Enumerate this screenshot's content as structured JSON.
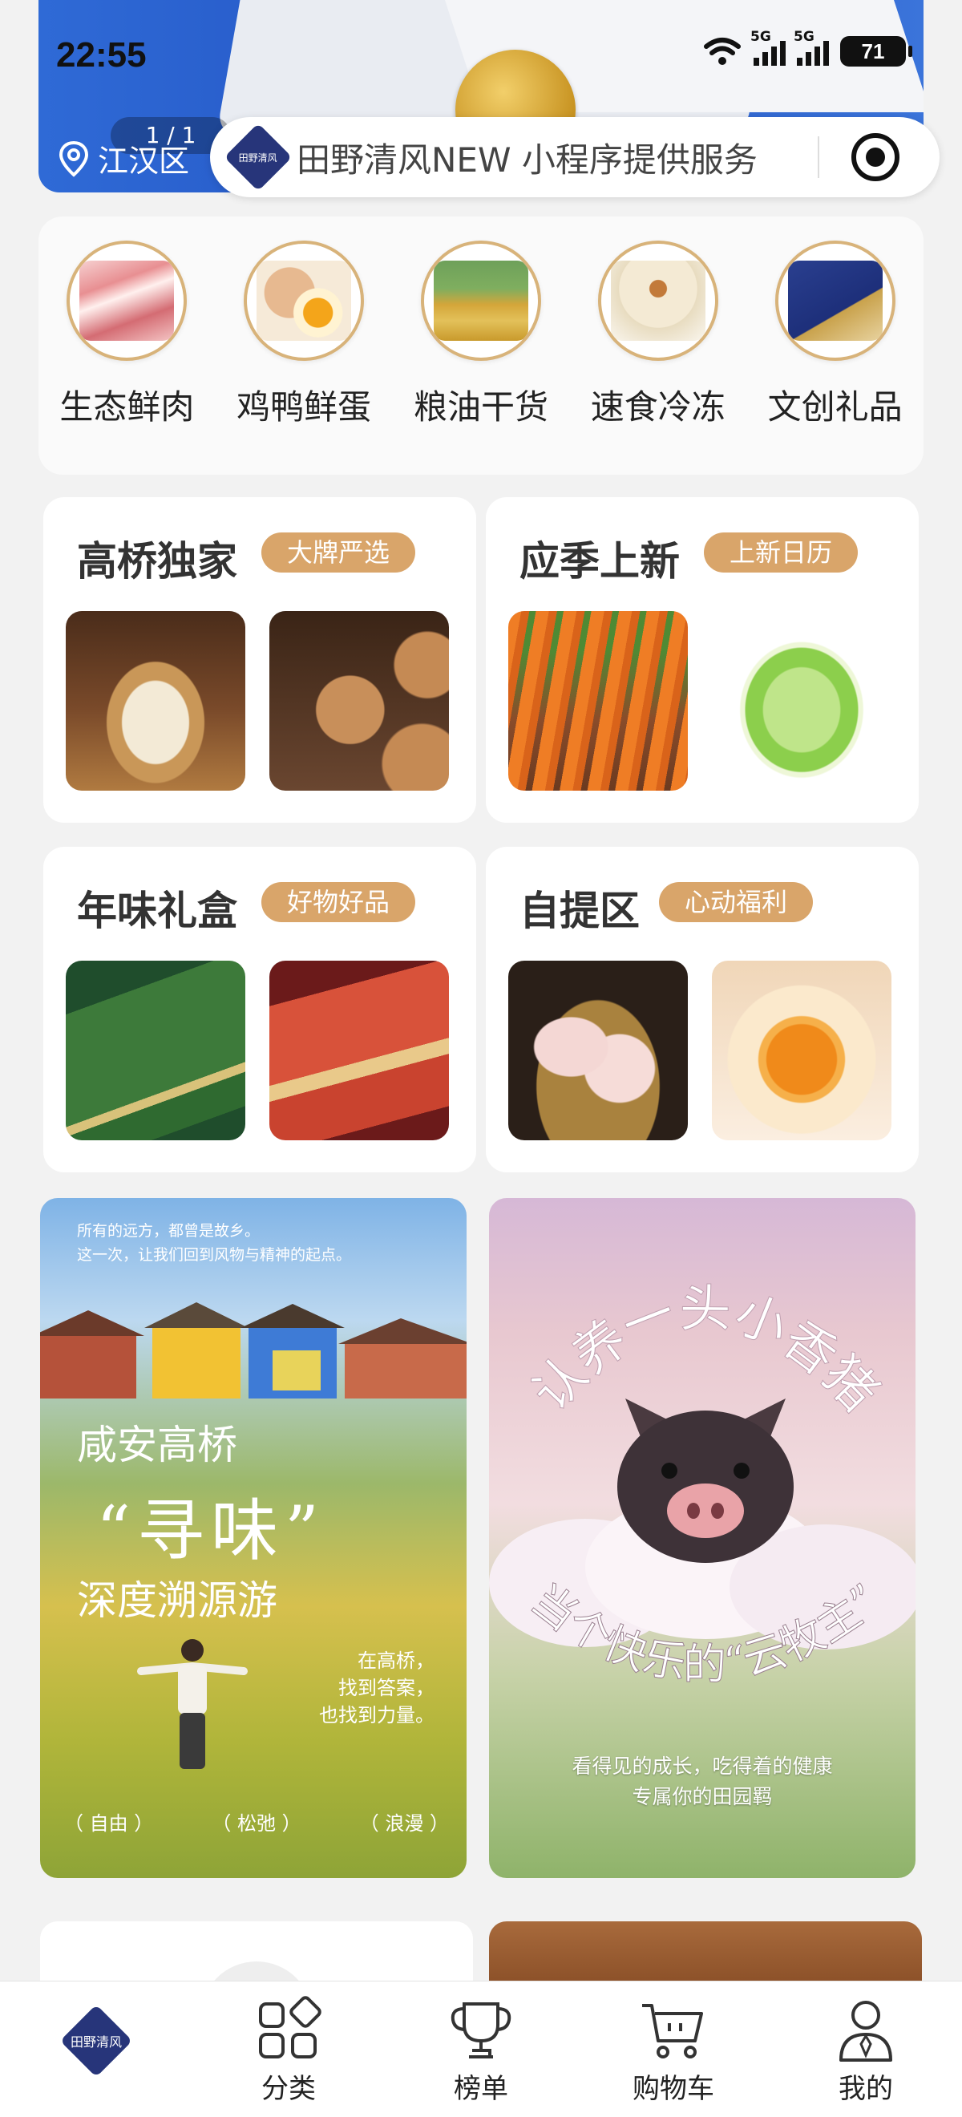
{
  "status_bar": {
    "time": "22:55",
    "network_1": "5G",
    "network_2": "5G",
    "battery": "71"
  },
  "banner": {
    "page_indicator": "1 / 1"
  },
  "location": {
    "district": "江汉区"
  },
  "search": {
    "logo_text": "田野清风",
    "service_text": "田野清风NEW 小程序提供服务"
  },
  "categories": [
    {
      "label": "生态鲜肉",
      "icon": "pork-icon"
    },
    {
      "label": "鸡鸭鲜蛋",
      "icon": "egg-icon"
    },
    {
      "label": "粮油干货",
      "icon": "grain-oil-icon"
    },
    {
      "label": "速食冷冻",
      "icon": "dumpling-icon"
    },
    {
      "label": "文创礼品",
      "icon": "gift-box-icon"
    }
  ],
  "feature_cards": [
    {
      "title": "高桥独家",
      "badge": "大牌严选"
    },
    {
      "title": "应季上新",
      "badge": "上新日历"
    },
    {
      "title": "年味礼盒",
      "badge": "好物好品"
    },
    {
      "title": "自提区",
      "badge": "心动福利"
    }
  ],
  "posters": {
    "left": {
      "intro_1": "所有的远方，都曾是故乡。",
      "intro_2": "这一次，让我们回到风物与精神的起点。",
      "title_1": "咸安高桥",
      "title_2": "“寻味”",
      "title_3": "深度溯源游",
      "sub_1": "在高桥，",
      "sub_2": "找到答案，",
      "sub_3": "也找到力量。",
      "tags": [
        "（ 自由 ）",
        "（ 松弛 ）",
        "（ 浪漫 ）"
      ]
    },
    "right": {
      "headline_1": "认养一头小香猪",
      "headline_2": "当个快乐的“云牧主”",
      "slogan_1": "看得见的成长，吃得着的健康",
      "slogan_2": "专属你的田园羁"
    }
  },
  "tabbar": {
    "home_logo": "田野清风",
    "items": [
      {
        "label": "分类",
        "icon": "category-icon"
      },
      {
        "label": "榜单",
        "icon": "trophy-icon"
      },
      {
        "label": "购物车",
        "icon": "cart-icon"
      },
      {
        "label": "我的",
        "icon": "profile-icon"
      }
    ]
  },
  "colors": {
    "badge": "#d9a56a",
    "brand_navy": "#27357a",
    "banner_blue": "#2f6ad6",
    "background": "#f2f2f2"
  }
}
